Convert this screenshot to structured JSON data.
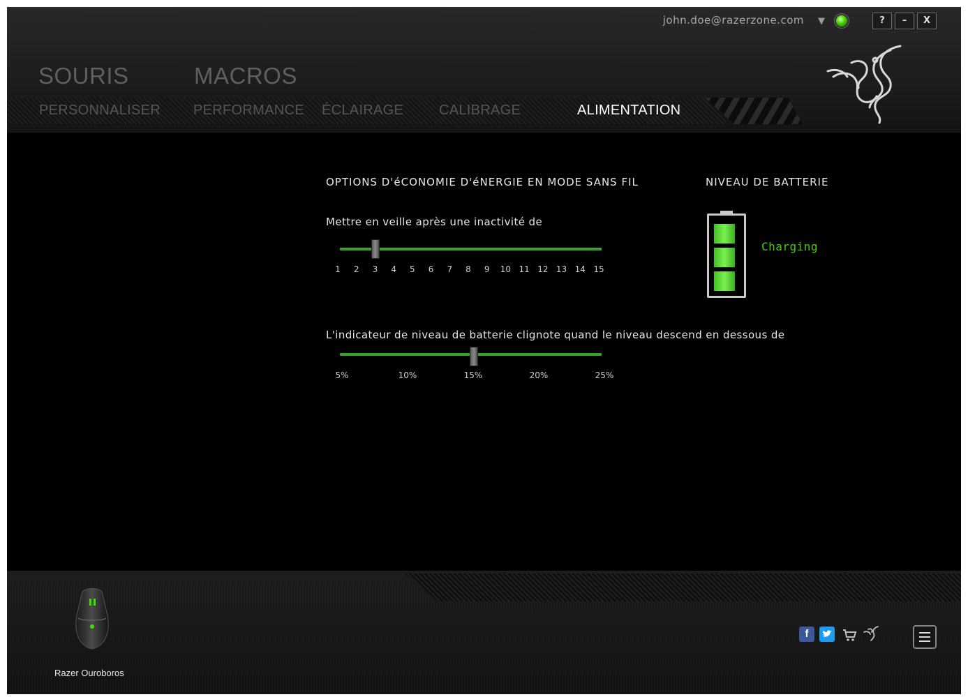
{
  "header": {
    "account_email": "john.doe@razerzone.com",
    "window_buttons": [
      "?",
      "–",
      "X"
    ],
    "categories": [
      "SOURIS",
      "MACROS"
    ],
    "tabs": [
      "PERSONNALISER",
      "PERFORMANCE",
      "ÉCLAIRAGE",
      "CALIBRAGE",
      "ALIMENTATION"
    ],
    "active_tab": "ALIMENTATION"
  },
  "power": {
    "title": "OPTIONS D'éCONOMIE D'éNERGIE EN MODE SANS FIL",
    "sleep_label": "Mettre en veille après une inactivité de",
    "sleep_ticks": [
      "1",
      "2",
      "3",
      "4",
      "5",
      "6",
      "7",
      "8",
      "9",
      "10",
      "11",
      "12",
      "13",
      "14",
      "15"
    ],
    "sleep_value": 3,
    "blink_label": "L'indicateur de niveau de batterie clignote quand le niveau descend en dessous de",
    "blink_ticks": [
      "5%",
      "10%",
      "15%",
      "20%",
      "25%"
    ],
    "blink_value": 15
  },
  "battery": {
    "title": "NIVEAU DE BATTERIE",
    "status": "Charging",
    "level_cells": 3,
    "color": "#44d000"
  },
  "footer": {
    "device_name": "Razer Ouroboros",
    "social_icons": [
      "facebook-icon",
      "twitter-icon",
      "cart-icon",
      "razer-icon"
    ]
  },
  "accent_color": "#39a22a"
}
